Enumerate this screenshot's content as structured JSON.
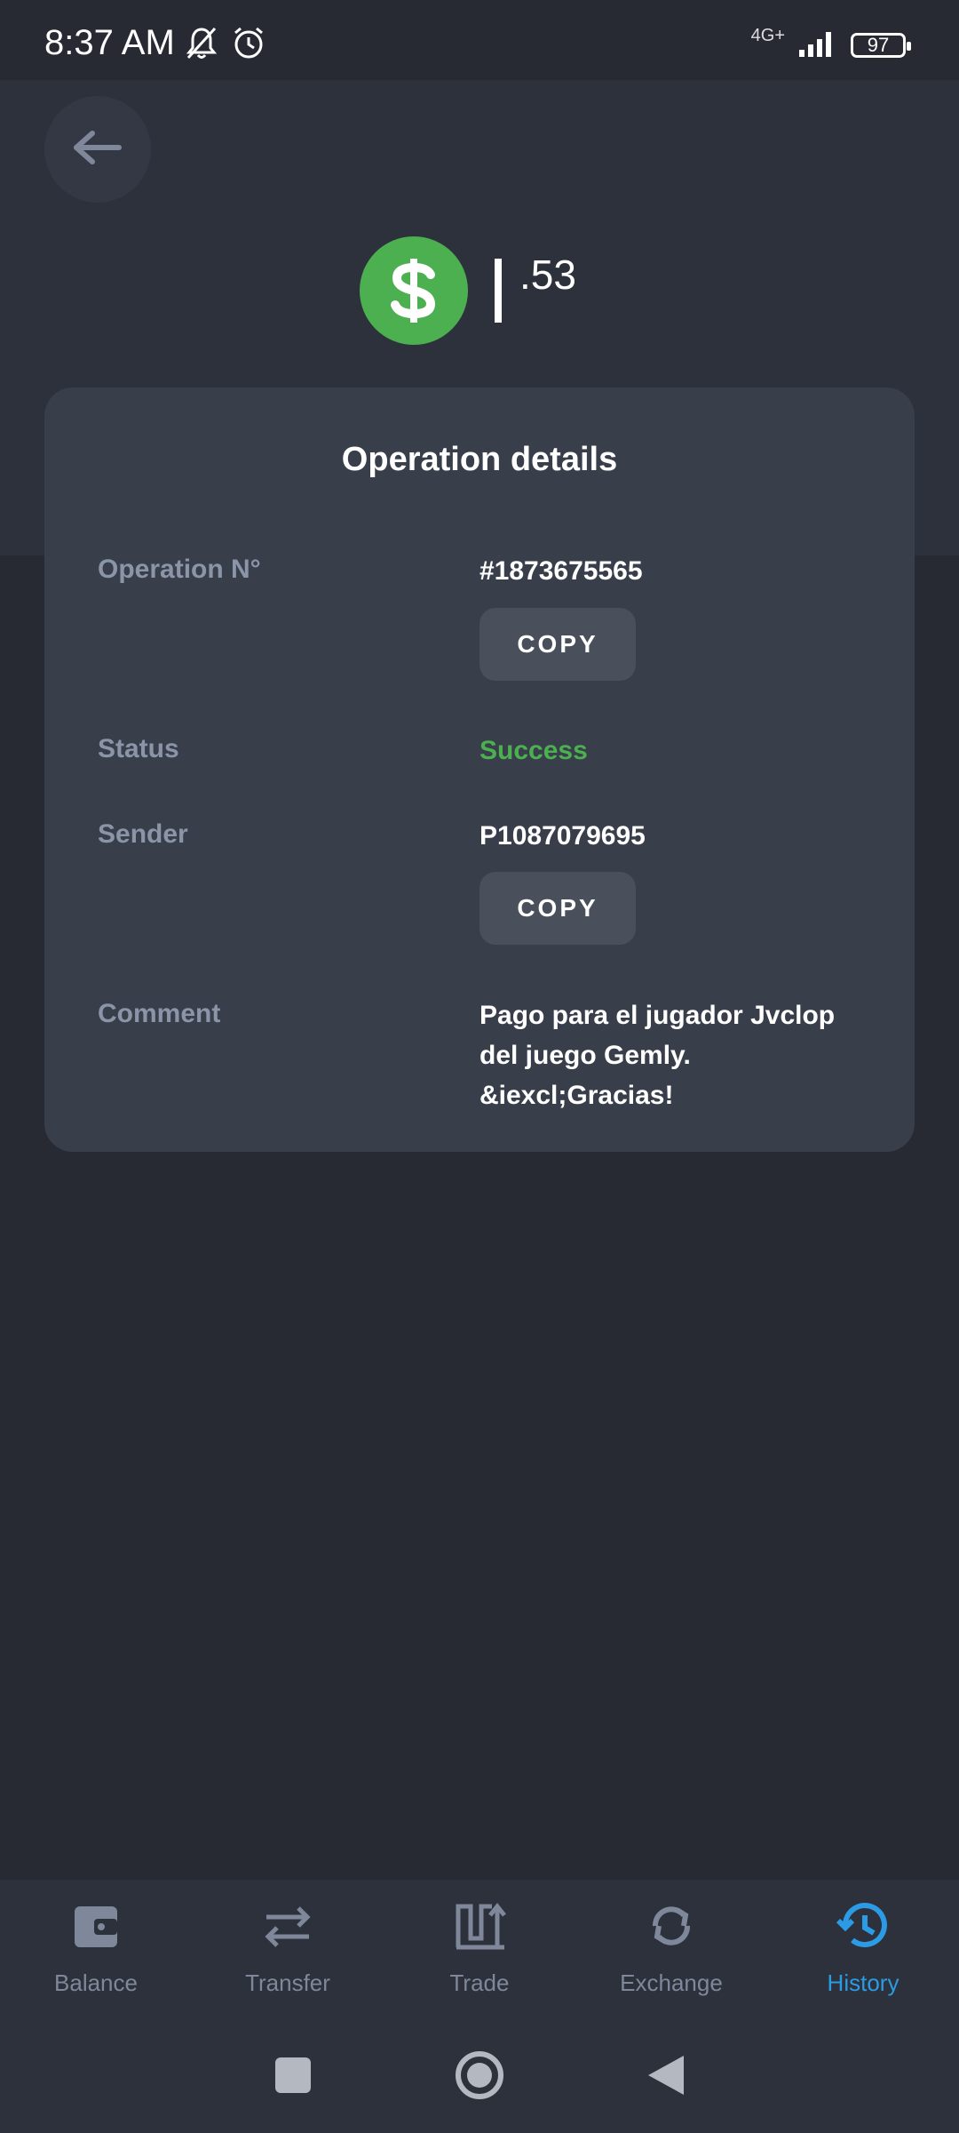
{
  "status_bar": {
    "time": "8:37 AM",
    "network": "4G+",
    "battery": "97"
  },
  "amount": {
    "currency_icon": "dollar-icon",
    "cents": ".53"
  },
  "card": {
    "title": "Operation details",
    "rows": {
      "operation_number": {
        "label": "Operation N°",
        "value": "#1873675565",
        "copy_label": "COPY"
      },
      "status": {
        "label": "Status",
        "value": "Success"
      },
      "sender": {
        "label": "Sender",
        "value": "P1087079695",
        "copy_label": "COPY"
      },
      "comment": {
        "label": "Comment",
        "value": "Pago para el jugador Jvclop del juego Gemly. &iexcl;Gracias!"
      }
    }
  },
  "colors": {
    "background": "#272a33",
    "card": "#393e4b",
    "success": "#4caf50",
    "active_tab": "#2b9be6",
    "muted": "#8b95a8"
  },
  "bottom_nav": {
    "items": [
      {
        "label": "Balance",
        "icon": "wallet-icon"
      },
      {
        "label": "Transfer",
        "icon": "arrows-icon"
      },
      {
        "label": "Trade",
        "icon": "trade-icon"
      },
      {
        "label": "Exchange",
        "icon": "refresh-icon"
      },
      {
        "label": "History",
        "icon": "history-icon",
        "active": true
      }
    ]
  }
}
